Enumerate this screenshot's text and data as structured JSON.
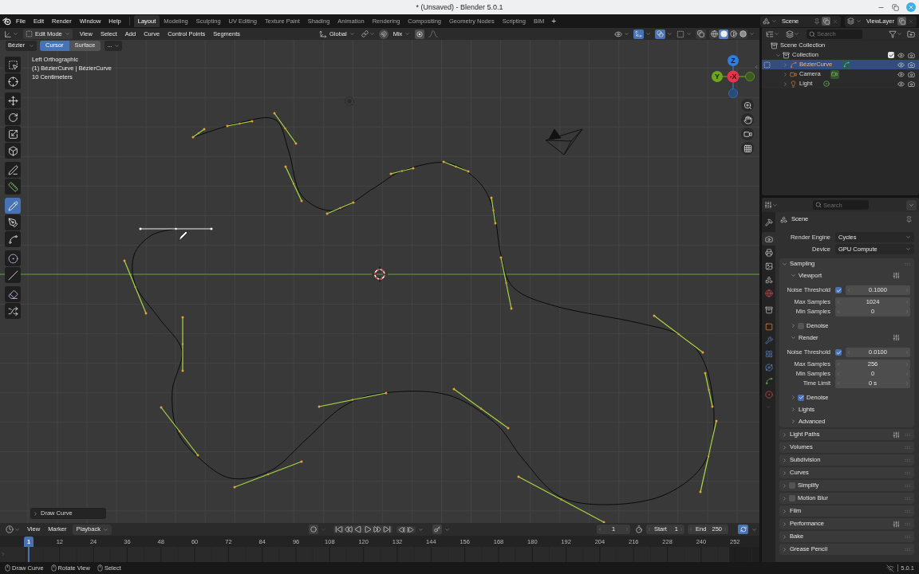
{
  "window": {
    "title": "* (Unsaved) - Blender 5.0.1"
  },
  "menu_bar": [
    "File",
    "Edit",
    "Render",
    "Window",
    "Help"
  ],
  "workspace_tabs": [
    {
      "label": "Layout",
      "selected": true
    },
    {
      "label": "Modeling",
      "selected": false
    },
    {
      "label": "Sculpting",
      "selected": false
    },
    {
      "label": "UV Editing",
      "selected": false
    },
    {
      "label": "Texture Paint",
      "selected": false
    },
    {
      "label": "Shading",
      "selected": false
    },
    {
      "label": "Animation",
      "selected": false
    },
    {
      "label": "Rendering",
      "selected": false
    },
    {
      "label": "Compositing",
      "selected": false
    },
    {
      "label": "Geometry Nodes",
      "selected": false
    },
    {
      "label": "Scripting",
      "selected": false
    },
    {
      "label": "BIM",
      "selected": false
    }
  ],
  "add_workspace": "+",
  "scene_selector": {
    "value": "Scene"
  },
  "view_layer_selector": {
    "value": "ViewLayer"
  },
  "viewport": {
    "header": {
      "mode": "Edit Mode",
      "menus": [
        "View",
        "Select",
        "Add",
        "Curve",
        "Control Points",
        "Segments"
      ],
      "transform_orientation": "Global",
      "dropdown_2": "Mix"
    },
    "toggles": [
      {
        "kind": "gizmos",
        "on": true
      },
      {
        "kind": "overlays",
        "on": true
      },
      {
        "kind": "xray",
        "on": false
      }
    ],
    "shading_modes": [
      {
        "kind": "wireframe",
        "selected": false
      },
      {
        "kind": "solid",
        "selected": true
      },
      {
        "kind": "material",
        "selected": false
      },
      {
        "kind": "rendered",
        "selected": false
      }
    ],
    "tool_settings": {
      "curve_type": "Bézier",
      "options": [
        {
          "label": "Cursor",
          "selected": true
        },
        {
          "label": "Surface",
          "selected": false
        }
      ],
      "more": "..."
    },
    "overlay_text": [
      "Left Orthographic",
      "(1) BézierCurve | BézierCurve",
      "10 Centimeters"
    ],
    "tools": [
      {
        "kind": "select",
        "selected": false
      },
      {
        "kind": "cursor",
        "selected": false
      },
      {
        "kind": "move",
        "selected": false
      },
      {
        "kind": "rotate",
        "selected": false
      },
      {
        "kind": "scale",
        "selected": false
      },
      {
        "kind": "transform",
        "selected": false
      },
      {
        "kind": "annotate",
        "selected": false
      },
      {
        "kind": "measure",
        "selected": false
      },
      {
        "kind": "draw",
        "selected": true
      },
      {
        "kind": "pen",
        "selected": false
      },
      {
        "kind": "extrude",
        "selected": false
      },
      {
        "kind": "radius",
        "selected": false
      },
      {
        "kind": "tilt",
        "selected": false
      },
      {
        "kind": "shrink",
        "selected": false
      },
      {
        "kind": "randomize",
        "selected": false
      }
    ],
    "navigation_gizmo": {
      "axis_labels": [
        "Z",
        "Y",
        "-X"
      ]
    },
    "last_operator": "Draw Curve"
  },
  "outliner": {
    "search_placeholder": "Search",
    "tree": [
      {
        "label": "Scene Collection",
        "kind": "collection",
        "selected": false,
        "children": [
          {
            "label": "Collection",
            "kind": "collection",
            "selected": false,
            "expanded": true,
            "checked": true,
            "children": [
              {
                "label": "BézierCurve",
                "kind": "curve",
                "selected": true,
                "expanded": false,
                "edit_mode": true
              },
              {
                "label": "Camera",
                "kind": "camera",
                "selected": false,
                "expanded": false
              },
              {
                "label": "Light",
                "kind": "light",
                "selected": false,
                "expanded": false
              }
            ]
          }
        ]
      }
    ]
  },
  "properties": {
    "search_placeholder": "Search",
    "tabs": [
      {
        "kind": "tool",
        "selected": false
      },
      {
        "kind": "render",
        "selected": true
      },
      {
        "kind": "output",
        "selected": false
      },
      {
        "kind": "view-layer",
        "selected": false
      },
      {
        "kind": "scene",
        "selected": false
      },
      {
        "kind": "world",
        "selected": false
      },
      {
        "kind": "collection",
        "selected": false
      },
      {
        "kind": "object",
        "selected": false
      },
      {
        "kind": "modifiers",
        "selected": false
      },
      {
        "kind": "particles",
        "selected": false
      },
      {
        "kind": "physics",
        "selected": false
      },
      {
        "kind": "data",
        "selected": false
      },
      {
        "kind": "material",
        "selected": false
      }
    ],
    "context": "Scene",
    "fields": [
      {
        "label": "Render Engine",
        "value": "Cycles"
      },
      {
        "label": "Device",
        "value": "GPU Compute"
      }
    ],
    "panels": [
      {
        "label": "Sampling",
        "expanded": true,
        "children": [
          {
            "label": "Viewport",
            "expanded": true,
            "presets": true,
            "rows": [
              {
                "kind": "toggle-number",
                "label": "Noise Threshold",
                "checked": true,
                "value": "0.1000"
              },
              {
                "kind": "number",
                "label": "Max Samples",
                "value": "1024"
              },
              {
                "kind": "number",
                "label": "Min Samples",
                "value": "0"
              }
            ],
            "children": [
              {
                "label": "Denoise",
                "expanded": false,
                "checked": false
              }
            ]
          },
          {
            "label": "Render",
            "expanded": true,
            "presets": true,
            "rows": [
              {
                "kind": "toggle-number",
                "label": "Noise Threshold",
                "checked": true,
                "value": "0.0100"
              },
              {
                "kind": "number",
                "label": "Max Samples",
                "value": "256"
              },
              {
                "kind": "number",
                "label": "Min Samples",
                "value": "0"
              },
              {
                "kind": "number",
                "label": "Time Limit",
                "value": "0 s"
              }
            ],
            "children": [
              {
                "label": "Denoise",
                "expanded": false,
                "checked": true
              }
            ]
          },
          {
            "label": "Lights",
            "expanded": false
          },
          {
            "label": "Advanced",
            "expanded": false
          }
        ]
      },
      {
        "label": "Light Paths",
        "expanded": false,
        "presets": true
      },
      {
        "label": "Volumes",
        "expanded": false
      },
      {
        "label": "Subdivision",
        "expanded": false
      },
      {
        "label": "Curves",
        "expanded": false
      },
      {
        "label": "Simplify",
        "expanded": false,
        "checked": false
      },
      {
        "label": "Motion Blur",
        "expanded": false,
        "checked": false
      },
      {
        "label": "Film",
        "expanded": false
      },
      {
        "label": "Performance",
        "expanded": false,
        "presets": true
      },
      {
        "label": "Bake",
        "expanded": false
      },
      {
        "label": "Grease Pencil",
        "expanded": false
      }
    ]
  },
  "timeline": {
    "menus": [
      "View",
      "Marker"
    ],
    "playback": "Playback",
    "current_frame": "1",
    "start_label": "Start",
    "start": "1",
    "end_label": "End",
    "end": "250",
    "ruler_labels": [
      "12",
      "24",
      "36",
      "48",
      "60",
      "72",
      "84",
      "96",
      "108",
      "120",
      "132",
      "144",
      "156",
      "168",
      "180",
      "192",
      "204",
      "216",
      "228",
      "240",
      "252"
    ],
    "playhead_label": "1"
  },
  "status_bar": {
    "hints": [
      "Draw Curve",
      "Rotate View",
      "Select"
    ],
    "version": "5.0.1"
  }
}
